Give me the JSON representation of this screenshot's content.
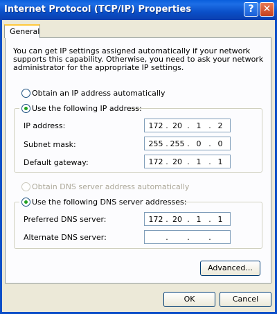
{
  "window": {
    "title": "Internet Protocol (TCP/IP) Properties",
    "help_glyph": "?",
    "close_glyph": "✕"
  },
  "tabs": [
    {
      "label": "General",
      "selected": true
    }
  ],
  "description": "You can get IP settings assigned automatically if your network supports this capability. Otherwise, you need to ask your network administrator for the appropriate IP settings.",
  "ip": {
    "auto_label": "Obtain an IP address automatically",
    "manual_label": "Use the following IP address:",
    "selected": "manual",
    "fields": [
      {
        "label": "IP address:",
        "octets": [
          "172",
          "20",
          "1",
          "2"
        ]
      },
      {
        "label": "Subnet mask:",
        "octets": [
          "255",
          "255",
          "0",
          "0"
        ]
      },
      {
        "label": "Default gateway:",
        "octets": [
          "172",
          "20",
          "1",
          "1"
        ]
      }
    ]
  },
  "dns": {
    "auto_label": "Obtain DNS server address automatically",
    "auto_enabled": false,
    "manual_label": "Use the following DNS server addresses:",
    "selected": "manual",
    "fields": [
      {
        "label": "Preferred DNS server:",
        "octets": [
          "172",
          "20",
          "1",
          "1"
        ]
      },
      {
        "label": "Alternate DNS server:",
        "octets": [
          "",
          "",
          "",
          ""
        ]
      }
    ]
  },
  "buttons": {
    "advanced": "Advanced...",
    "ok": "OK",
    "cancel": "Cancel"
  },
  "ip_separator": "."
}
